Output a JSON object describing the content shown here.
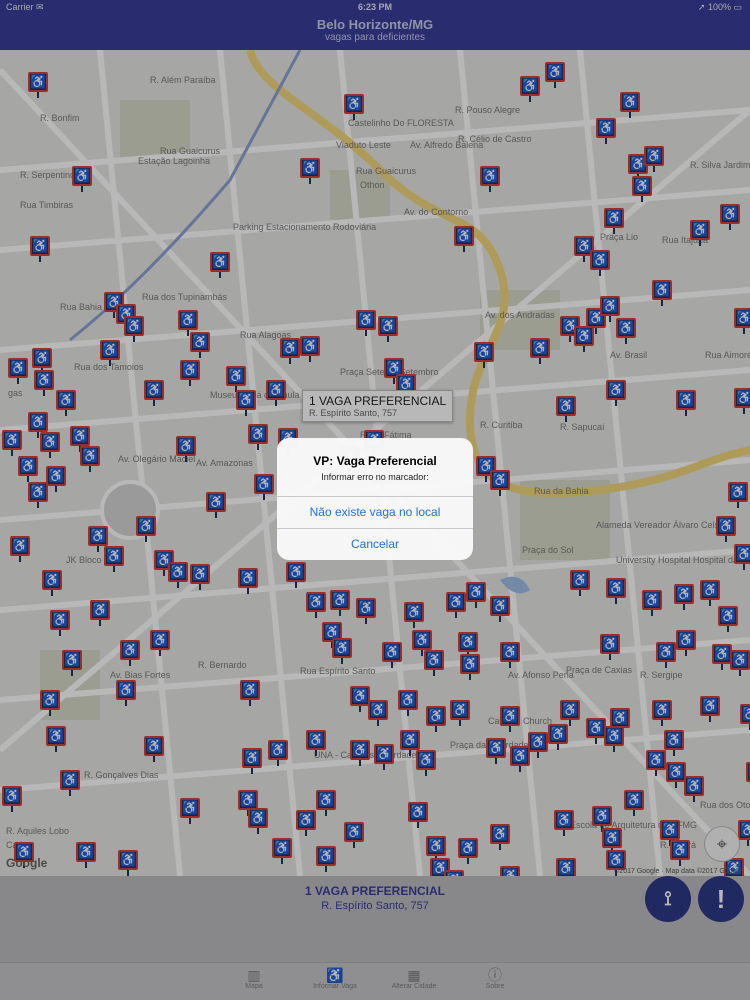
{
  "status_bar": {
    "carrier": "Carrier ✉",
    "time": "6:23 PM",
    "battery": "➚ 100% ▭"
  },
  "nav": {
    "title": "Belo Horizonte/MG",
    "subtitle": "vagas para deficientes"
  },
  "map": {
    "street_labels": [
      "R. Além Paraíba",
      "R. Bonfim",
      "Estação Lagoinha",
      "Castelinho Do FLORESTA",
      "R. Pouso Alegre",
      "R. Célio de Castro",
      "Av. do Contorno",
      "Viaduto Leste",
      "Rua Guaicurus",
      "Rua dos Tupinambás",
      "Rua dos Tamoios",
      "Parking Estacionamento Rodoviária",
      "Praça Sete de Setembro",
      "Av. dos Andradas",
      "Av. Amazonas",
      "Av. Olegário Maciel",
      "JK Bloco",
      "Praça do Sol",
      "Alameda Vereador Álvaro Celso",
      "University Hospital Hospital das Clínicas (UFMG)",
      "Praça de Caxias",
      "Catholic Church",
      "Escola de Arquitetura da UFMG",
      "UNA - Campus Liberdade",
      "R. Gonçalves Dias",
      "Av. Brasil",
      "Rua Espírito Santo",
      "Av. Afonso Pena",
      "Museu Inimá de Paula",
      "Praça da Liberdade",
      "R. Sergipe",
      "Rua dos Otoni",
      "R. Ceará",
      "R. Bernardo",
      "Av. Bias Fortes",
      "R. Curitiba",
      "Av. Alfredo Balena",
      "Rua Aimorés",
      "Praça Lio",
      "Rua Itajubá",
      "R. Silva Jardim",
      "R. Sapucaí",
      "R. Aquiles Lobo",
      "Carlos",
      "gas",
      "Othon",
      "Rua Guaicurus",
      "Rua Bahia",
      "Rua Timbiras",
      "R. Serpentino",
      "R. de Fátima",
      "Rua Alagoas",
      "Rua da Bahia"
    ],
    "icon": "wheelchair-parking-icon",
    "callout": {
      "title": "1 VAGA PREFERENCIAL",
      "subtitle": "R. Espírito Santo, 757"
    },
    "attribution": "Google",
    "map_data": "©2017 Google · Map data ©2017 Google"
  },
  "dialog": {
    "title": "VP: Vaga Preferencial",
    "message": "Informar erro no marcador:",
    "option_1": "Não existe vaga no local",
    "option_2": "Cancelar"
  },
  "info_panel": {
    "title": "1 VAGA PREFERENCIAL",
    "address": "R. Espírito Santo, 757"
  },
  "tabs": [
    {
      "label": "Mapa",
      "icon": "map-icon"
    },
    {
      "label": "Informar Vaga",
      "icon": "wheelchair-icon"
    },
    {
      "label": "Alterar Cidade",
      "icon": "city-icon"
    },
    {
      "label": "Sobre",
      "icon": "info-icon"
    }
  ],
  "colors": {
    "nav": "#3a3f9a",
    "pin": "#27325e",
    "pin_border": "#d8413a",
    "link": "#1f6fe0"
  }
}
